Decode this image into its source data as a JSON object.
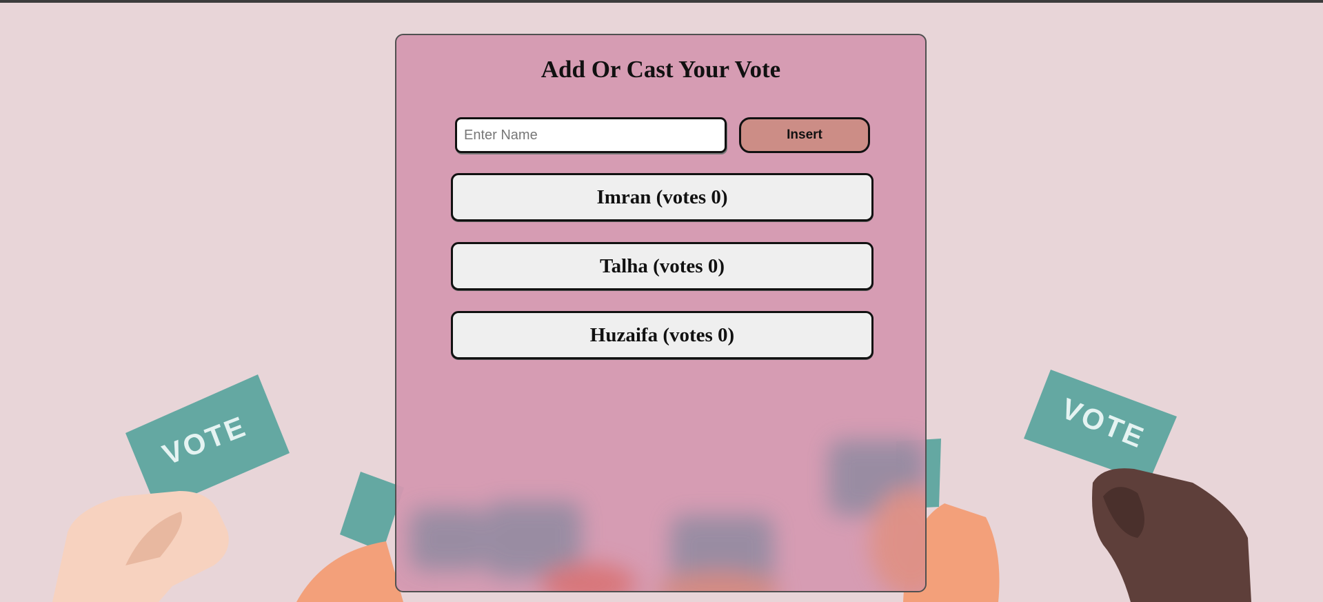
{
  "page": {
    "title": "Add Or Cast Your Vote"
  },
  "form": {
    "name_placeholder": "Enter Name",
    "name_value": "",
    "insert_label": "Insert"
  },
  "candidates": [
    {
      "label": "Imran (votes 0)"
    },
    {
      "label": "Talha (votes 0)"
    },
    {
      "label": "Huzaifa (votes 0)"
    }
  ],
  "background": {
    "vote_card_text": "VOTE",
    "page_color": "#e8d5d8",
    "card_color": "#d498b0",
    "vote_card_color": "#64a8a2",
    "accent_button_color": "#cc8d86"
  }
}
